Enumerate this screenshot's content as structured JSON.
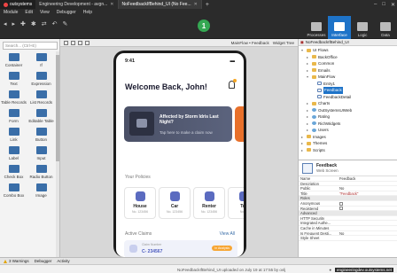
{
  "titlebar": {
    "logo": "outsystems",
    "tabs": [
      {
        "label": "Engineering Development - avgn...",
        "active": false
      },
      {
        "label": "NoFeedbackIfBehind_UI (No Fee...",
        "active": true
      }
    ],
    "window_controls": [
      "–",
      "□",
      "✕"
    ]
  },
  "menubar": {
    "items": [
      "Module",
      "Edit",
      "View",
      "Debugger",
      "Help"
    ]
  },
  "toolbar": {
    "step_badge": "1",
    "modes": [
      {
        "label": "Processes",
        "active": false
      },
      {
        "label": "Interface",
        "active": true
      },
      {
        "label": "Logic",
        "active": false
      },
      {
        "label": "Data",
        "active": false
      }
    ]
  },
  "left_panel": {
    "search_placeholder": "Search... (Ctrl+E)",
    "widgets": [
      "Container",
      "If",
      "Text",
      "Expression",
      "Table Records",
      "List Records",
      "Form",
      "Editable Table",
      "Link",
      "Button",
      "Label",
      "Input",
      "Check Box",
      "Radio Button",
      "Combo Box",
      "Image"
    ]
  },
  "canvas": {
    "breadcrumb": "MainFlow • Feedback",
    "widget_tree": "Widget Tree",
    "phone": {
      "time": "9:41",
      "greeting": "Welcome Back, John!",
      "alert_title": "Affected by Storm Idris Last Night?",
      "alert_sub": "Tap here to make a claim now",
      "policies_title": "Your Policies",
      "policies": [
        {
          "name": "House",
          "number": "No. 123456"
        },
        {
          "name": "Car",
          "number": "No. 123456"
        },
        {
          "name": "Renter",
          "number": "No. 123456"
        },
        {
          "name": "Tra",
          "number": "No. 1"
        }
      ],
      "claims_title": "Active Claims",
      "view_all": "View All",
      "claim_label": "Claim Number",
      "claim_number": "C- 234567",
      "claim_status": "In Analysis"
    }
  },
  "right_panel": {
    "tab_label": "NoFeedbackIfBehind_UI",
    "tree": [
      {
        "indent": 0,
        "label": "UI Flows",
        "type": "folder",
        "tw": "▾"
      },
      {
        "indent": 1,
        "label": "BackOffice",
        "type": "folder",
        "tw": "▸"
      },
      {
        "indent": 1,
        "label": "Common",
        "type": "folder",
        "tw": "▸"
      },
      {
        "indent": 1,
        "label": "Emails",
        "type": "folder",
        "tw": "▸"
      },
      {
        "indent": 1,
        "label": "MainFlow",
        "type": "folder",
        "tw": "▾"
      },
      {
        "indent": 2,
        "label": "Entry1",
        "type": "page",
        "tw": ""
      },
      {
        "indent": 2,
        "label": "Feedback",
        "type": "page",
        "tw": "",
        "selected": true
      },
      {
        "indent": 2,
        "label": "FeedbackDetail",
        "type": "page",
        "tw": ""
      },
      {
        "indent": 1,
        "label": "Charts",
        "type": "folder",
        "tw": "▸"
      },
      {
        "indent": 1,
        "label": "OutSystemsUIWeb",
        "type": "ent",
        "tw": "▸"
      },
      {
        "indent": 1,
        "label": "Rating",
        "type": "ent",
        "tw": "▸"
      },
      {
        "indent": 1,
        "label": "RichWidgets",
        "type": "ent",
        "tw": "▸"
      },
      {
        "indent": 1,
        "label": "Users",
        "type": "ent",
        "tw": "▸"
      },
      {
        "indent": 0,
        "label": "Images",
        "type": "folder",
        "tw": "▸"
      },
      {
        "indent": 0,
        "label": "Themes",
        "type": "folder",
        "tw": "▸"
      },
      {
        "indent": 0,
        "label": "Scripts",
        "type": "folder",
        "tw": "▸"
      }
    ],
    "props_header": {
      "title": "Feedback",
      "subtitle": "Web Screen"
    },
    "props": [
      {
        "k": "Name",
        "v": "Feedback",
        "group": false
      },
      {
        "k": "Description",
        "v": "",
        "group": false
      },
      {
        "k": "Public",
        "v": "No",
        "group": false
      },
      {
        "k": "Title",
        "v": "\"Feedback\"",
        "group": false,
        "red": true
      },
      {
        "k": "Roles",
        "v": "",
        "group": true
      },
      {
        "k": "Anonymous",
        "v": "",
        "group": false,
        "cb": true
      },
      {
        "k": "Registered",
        "v": "",
        "group": false,
        "cb": true
      },
      {
        "k": "Advanced",
        "v": "",
        "group": true
      },
      {
        "k": "HTTP Security",
        "v": "",
        "group": false
      },
      {
        "k": "Integrated Authe...",
        "v": "",
        "group": false
      },
      {
        "k": "Cache in Minutes",
        "v": "",
        "group": false
      },
      {
        "k": "Is Frequent Desti...",
        "v": "No",
        "group": false
      },
      {
        "k": "Style Sheet",
        "v": "",
        "group": false
      }
    ]
  },
  "bottom": {
    "warnings": "3 Warnings",
    "tabs": [
      "Debugger",
      "Activity"
    ],
    "status_message": "NoFeedbackIfBehind_UI uploaded on July 19 at 17:55 by ovlj",
    "env": "engineeringdev.outsystems.net"
  }
}
